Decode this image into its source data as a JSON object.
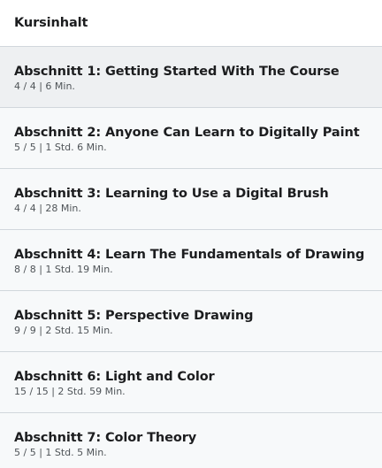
{
  "header": {
    "title": "Kursinhalt"
  },
  "sections": [
    {
      "title": "Abschnitt 1: Getting Started With The Course",
      "meta": "4 / 4 | 6 Min.",
      "active": true
    },
    {
      "title": "Abschnitt 2: Anyone Can Learn to Digitally Paint",
      "meta": "5 / 5 | 1 Std. 6 Min."
    },
    {
      "title": "Abschnitt 3: Learning to Use a Digital Brush",
      "meta": "4 / 4 | 28 Min."
    },
    {
      "title": "Abschnitt 4: Learn The Fundamentals of Drawing",
      "meta": "8 / 8 | 1 Std. 19 Min."
    },
    {
      "title": "Abschnitt 5: Perspective Drawing",
      "meta": "9 / 9 | 2 Std. 15 Min."
    },
    {
      "title": "Abschnitt 6: Light and Color",
      "meta": "15 / 15 | 2 Std. 59 Min."
    },
    {
      "title": "Abschnitt 7: Color Theory",
      "meta": "5 / 5 | 1 Std. 5 Min."
    }
  ]
}
